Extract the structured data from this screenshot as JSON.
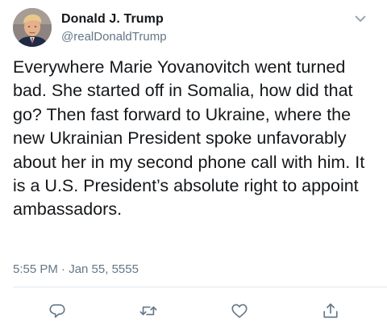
{
  "tweet": {
    "author": {
      "display_name": "Donald J. Trump",
      "handle": "@realDonaldTrump",
      "avatar_icon": "profile-photo"
    },
    "text": "Everywhere Marie Yovanovitch went turned bad. She started off in Somalia, how did that go? Then fast forward to Ukraine, where the new Ukrainian President spoke unfavorably about her in my second phone call with him. It is a U.S. President’s absolute right to appoint ambassadors.",
    "timestamp": "5:55 PM · Jan 55, 5555",
    "menu_icon": "chevron-down-icon",
    "actions": [
      {
        "name": "reply",
        "icon": "reply-icon"
      },
      {
        "name": "retweet",
        "icon": "retweet-icon"
      },
      {
        "name": "like",
        "icon": "heart-icon"
      },
      {
        "name": "share",
        "icon": "share-icon"
      }
    ]
  },
  "colors": {
    "text": "#14171a",
    "secondary": "#657786",
    "divider": "#e1e8ed",
    "background": "#ffffff"
  }
}
